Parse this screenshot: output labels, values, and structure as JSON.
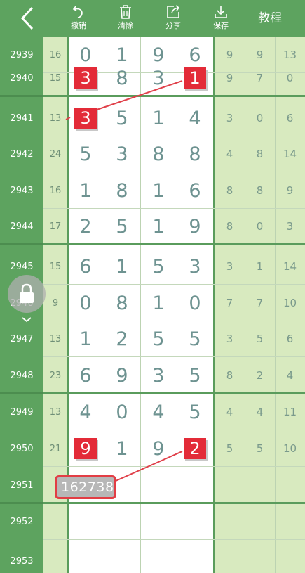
{
  "toolbar": {
    "back_icon": "chevron-left-icon",
    "undo": {
      "label": "撤销",
      "icon": "undo-icon"
    },
    "clear": {
      "label": "清除",
      "icon": "trash-icon"
    },
    "share": {
      "label": "分享",
      "icon": "share-icon"
    },
    "save": {
      "label": "保存",
      "icon": "download-icon"
    },
    "tutorial": "教程"
  },
  "colors": {
    "toolbar": "#5da35f",
    "issue_column": "#5da35f",
    "sum_column": "#d8eabf",
    "stat_columns": "#d8eabf",
    "mark": "#e32b38",
    "digit_text": "#6e9391"
  },
  "rows": [
    {
      "issue": "2939",
      "sum": "16",
      "digits": [
        "0",
        "1",
        "9",
        "6"
      ],
      "stats": [
        "9",
        "9",
        "13"
      ],
      "marked": []
    },
    {
      "issue": "2940",
      "sum": "15",
      "digits": [
        "3",
        "8",
        "3",
        "1"
      ],
      "stats": [
        "9",
        "7",
        "0"
      ],
      "marked": [
        0,
        3
      ]
    },
    {
      "issue": "2941",
      "sum": "13",
      "digits": [
        "3",
        "5",
        "1",
        "4"
      ],
      "stats": [
        "3",
        "0",
        "6"
      ],
      "marked": [
        0
      ]
    },
    {
      "issue": "2942",
      "sum": "24",
      "digits": [
        "5",
        "3",
        "8",
        "8"
      ],
      "stats": [
        "4",
        "8",
        "14"
      ],
      "marked": []
    },
    {
      "issue": "2943",
      "sum": "16",
      "digits": [
        "1",
        "8",
        "1",
        "6"
      ],
      "stats": [
        "8",
        "8",
        "9"
      ],
      "marked": []
    },
    {
      "issue": "2944",
      "sum": "17",
      "digits": [
        "2",
        "5",
        "1",
        "9"
      ],
      "stats": [
        "8",
        "0",
        "3"
      ],
      "marked": []
    },
    {
      "issue": "2945",
      "sum": "15",
      "digits": [
        "6",
        "1",
        "5",
        "3"
      ],
      "stats": [
        "3",
        "1",
        "14"
      ],
      "marked": []
    },
    {
      "issue": "2946",
      "sum": "9",
      "digits": [
        "0",
        "8",
        "1",
        "0"
      ],
      "stats": [
        "7",
        "7",
        "10"
      ],
      "marked": []
    },
    {
      "issue": "2947",
      "sum": "13",
      "digits": [
        "1",
        "2",
        "5",
        "5"
      ],
      "stats": [
        "3",
        "5",
        "6"
      ],
      "marked": []
    },
    {
      "issue": "2948",
      "sum": "23",
      "digits": [
        "6",
        "9",
        "3",
        "5"
      ],
      "stats": [
        "8",
        "2",
        "4"
      ],
      "marked": []
    },
    {
      "issue": "2949",
      "sum": "13",
      "digits": [
        "4",
        "0",
        "4",
        "5"
      ],
      "stats": [
        "4",
        "4",
        "11"
      ],
      "marked": []
    },
    {
      "issue": "2950",
      "sum": "21",
      "digits": [
        "9",
        "1",
        "9",
        "2"
      ],
      "stats": [
        "5",
        "5",
        "10"
      ],
      "marked": [
        0,
        3
      ]
    },
    {
      "issue": "2951",
      "sum": "",
      "digits": [
        "",
        "",
        "",
        ""
      ],
      "stats": [
        "",
        "",
        ""
      ],
      "marked": []
    },
    {
      "issue": "2952",
      "sum": "",
      "digits": [
        "",
        "",
        "",
        ""
      ],
      "stats": [
        "",
        "",
        ""
      ],
      "marked": []
    },
    {
      "issue": "2953",
      "sum": "",
      "digits": [
        "",
        "",
        "",
        ""
      ],
      "stats": [
        "",
        "",
        ""
      ],
      "marked": []
    }
  ],
  "input": {
    "value": "162738"
  },
  "lock_icon": "lock-icon"
}
